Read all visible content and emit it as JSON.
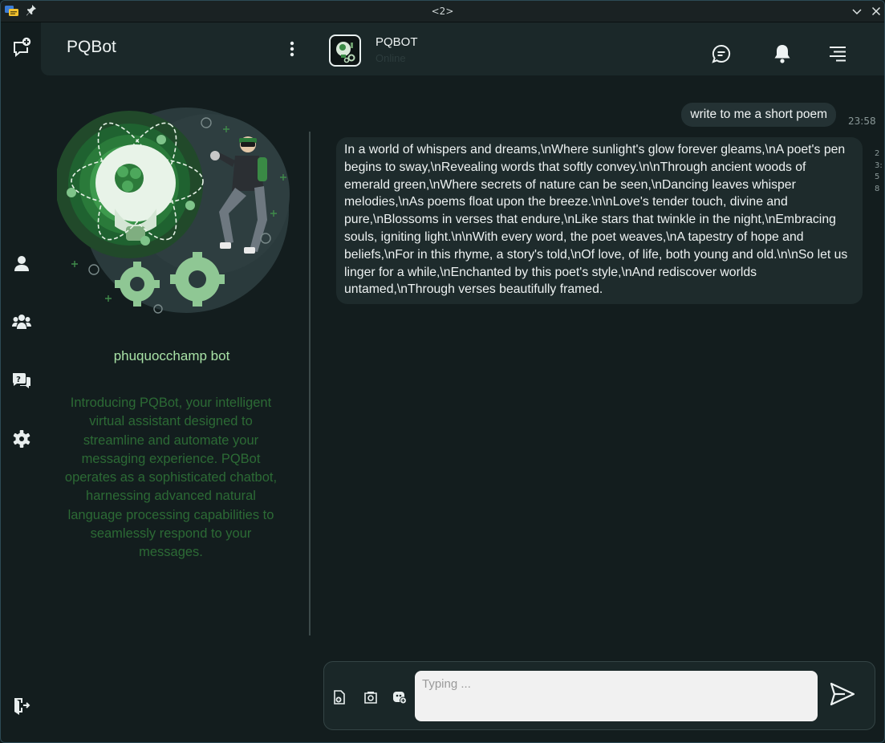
{
  "window": {
    "title": "<2>"
  },
  "sidebar": {
    "title": "PQBot",
    "bot_name": "phuquocchamp bot",
    "description": "Introducing PQBot, your intelligent virtual assistant designed to streamline and automate your messaging experience. PQBot operates as a sophisticated chatbot, harnessing advanced natural language processing capabilities to seamlessly respond to your messages."
  },
  "rail": {
    "icons": [
      "new-chat-icon",
      "user-icon",
      "group-icon",
      "help-chat-icon",
      "settings-icon",
      "logout-icon"
    ]
  },
  "chat_header": {
    "name": "PQBOT",
    "status": "Online"
  },
  "messages": {
    "outgoing": {
      "text": "write to me a short poem",
      "time": "23:58"
    },
    "incoming": {
      "text": "In a world of whispers and dreams,\\nWhere sunlight's glow forever gleams,\\nA poet's pen begins to sway,\\nRevealing words that softly convey.\\n\\nThrough ancient woods of emerald green,\\nWhere secrets of nature can be seen,\\nDancing leaves whisper melodies,\\nAs poems float upon the breeze.\\n\\nLove's tender touch, divine and pure,\\nBlossoms in verses that endure,\\nLike stars that twinkle in the night,\\nEmbracing souls, igniting light.\\n\\nWith every word, the poet weaves,\\nA tapestry of hope and beliefs,\\nFor in this rhyme, a story's told,\\nOf love, of life, both young and old.\\n\\nSo let us linger for a while,\\nEnchanted by this poet's style,\\nAnd rediscover worlds untamed,\\nThrough verses beautifully framed.",
      "time": "23:58"
    }
  },
  "composer": {
    "placeholder": "Typing ..."
  },
  "colors": {
    "accent": "#a8e2a6",
    "description": "#2c6a35",
    "background": "#131d1e",
    "header": "#1b2829"
  }
}
